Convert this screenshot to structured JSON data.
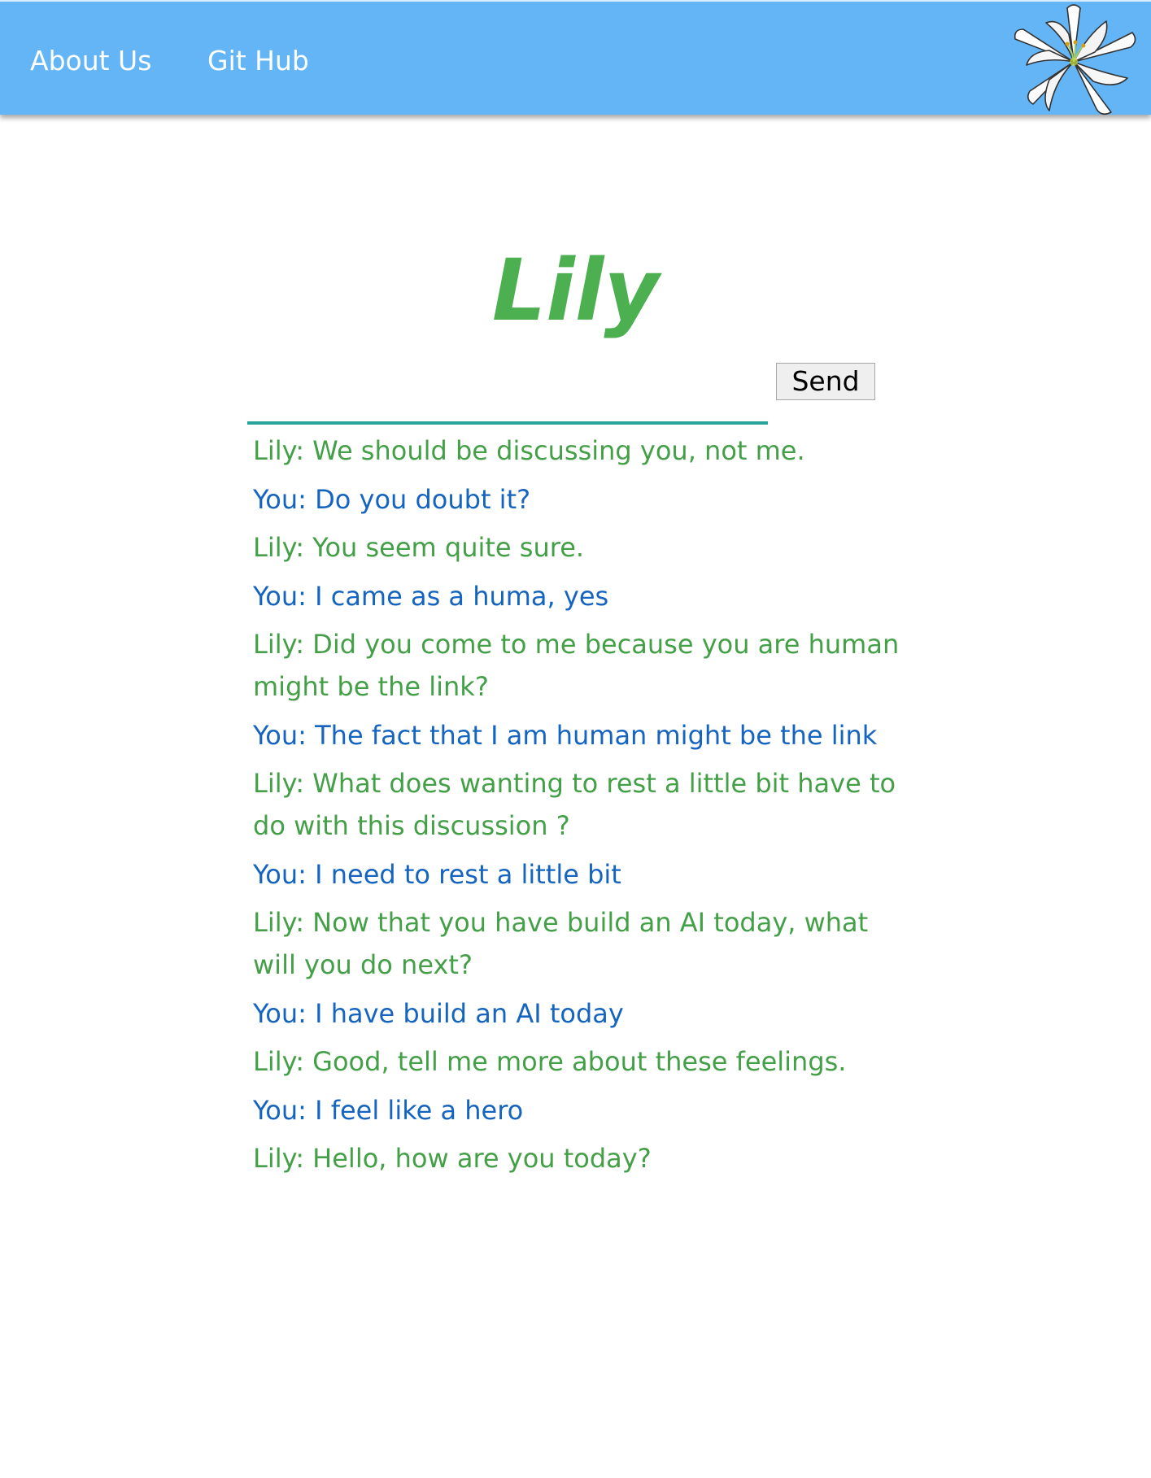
{
  "nav": {
    "links": [
      "About Us",
      "Git Hub"
    ],
    "logo_icon": "lily-flower-icon"
  },
  "title": "Lily",
  "input": {
    "value": "",
    "placeholder": ""
  },
  "send_label": "Send",
  "colors": {
    "navbar": "#64b5f6",
    "title": "#4caf50",
    "lily_message": "#43a047",
    "you_message": "#1565c0",
    "input_underline": "#26a69a"
  },
  "messages": [
    {
      "speaker": "lily",
      "text": "Lily: We should be discussing you, not me."
    },
    {
      "speaker": "you",
      "text": "You: Do you doubt it?"
    },
    {
      "speaker": "lily",
      "text": "Lily: You seem quite sure."
    },
    {
      "speaker": "you",
      "text": "You: I came as a huma, yes"
    },
    {
      "speaker": "lily",
      "text": "Lily: Did you come to me because you are human might be the link?"
    },
    {
      "speaker": "you",
      "text": "You: The fact that I am human might be the link"
    },
    {
      "speaker": "lily",
      "text": "Lily: What does wanting to rest a little bit have to do with this discussion ?"
    },
    {
      "speaker": "you",
      "text": "You: I need to rest a little bit"
    },
    {
      "speaker": "lily",
      "text": "Lily: Now that you have build an AI today, what will you do next?"
    },
    {
      "speaker": "you",
      "text": "You: I have build an AI today"
    },
    {
      "speaker": "lily",
      "text": "Lily: Good, tell me more about these feelings."
    },
    {
      "speaker": "you",
      "text": "You: I feel like a hero"
    },
    {
      "speaker": "lily",
      "text": "Lily: Hello, how are you today?"
    }
  ]
}
